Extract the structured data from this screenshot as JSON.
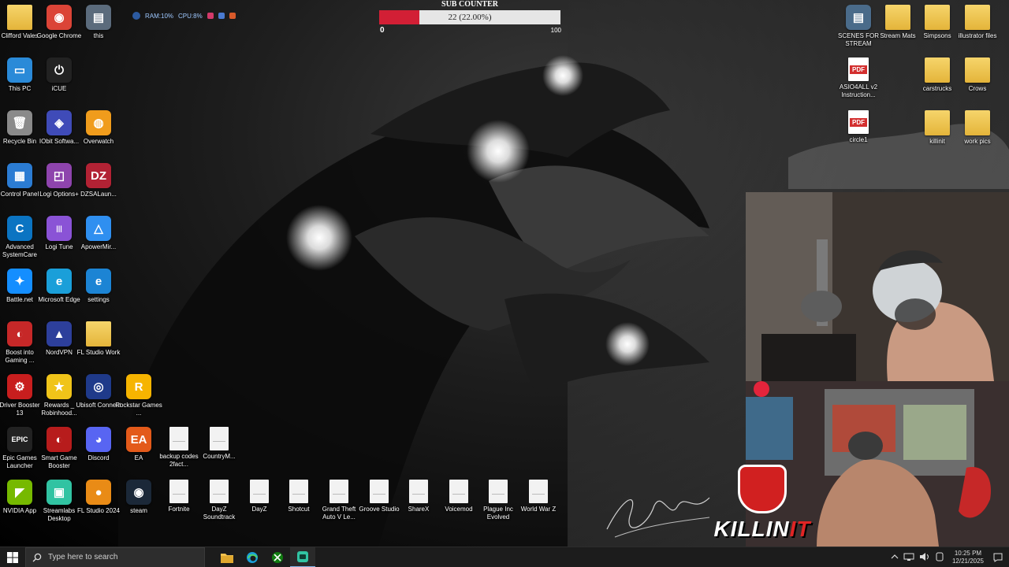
{
  "desktop": {
    "icons": [
      {
        "id": "clifford-vales",
        "label": "Clifford Vales",
        "kind": "folder",
        "color": "#e4b43a",
        "glyph": ""
      },
      {
        "id": "google-chrome",
        "label": "Google Chrome",
        "kind": "app",
        "color": "#db4437",
        "glyph": "◉"
      },
      {
        "id": "this",
        "label": "this",
        "kind": "app",
        "color": "#5b6b7c",
        "glyph": "▤"
      },
      {
        "id": "this-pc",
        "label": "This PC",
        "kind": "app",
        "color": "#2a8ad8",
        "glyph": "▭"
      },
      {
        "id": "icue",
        "label": "iCUE",
        "kind": "app",
        "color": "#222222",
        "glyph": "⏻"
      },
      {
        "id": "recycle-bin",
        "label": "Recycle Bin",
        "kind": "app",
        "color": "#8a8a8a",
        "glyph": "🗑"
      },
      {
        "id": "iobit-software",
        "label": "IObit Softwa...",
        "kind": "app",
        "color": "#3f4bb8",
        "glyph": "◈"
      },
      {
        "id": "overwatch",
        "label": "Overwatch",
        "kind": "app",
        "color": "#f09c1c",
        "glyph": "◍"
      },
      {
        "id": "control-panel",
        "label": "Control Panel",
        "kind": "app",
        "color": "#2b7cd3",
        "glyph": "▦"
      },
      {
        "id": "logi-options",
        "label": "Logi Options+",
        "kind": "app",
        "color": "#8e44ad",
        "glyph": "◰"
      },
      {
        "id": "dzsalauncher",
        "label": "DZSALaun...",
        "kind": "app",
        "color": "#b22234",
        "glyph": "DZ"
      },
      {
        "id": "advanced-systemcare",
        "label": "Advanced SystemCare",
        "kind": "app",
        "color": "#0b74c2",
        "glyph": "C"
      },
      {
        "id": "logi-tune",
        "label": "Logi Tune",
        "kind": "app",
        "color": "#8a53d6",
        "glyph": "|||"
      },
      {
        "id": "apowermirror",
        "label": "ApowerMir...",
        "kind": "app",
        "color": "#2f8ff0",
        "glyph": "△"
      },
      {
        "id": "battle-net",
        "label": "Battle.net",
        "kind": "app",
        "color": "#148eff",
        "glyph": "✦"
      },
      {
        "id": "microsoft-edge",
        "label": "Microsoft Edge",
        "kind": "app",
        "color": "#1a9fd9",
        "glyph": "e"
      },
      {
        "id": "settings",
        "label": "settings",
        "kind": "app",
        "color": "#1c84d4",
        "glyph": "e"
      },
      {
        "id": "boost-into-gaming",
        "label": "Boost into Gaming ...",
        "kind": "app",
        "color": "#c62828",
        "glyph": "◐"
      },
      {
        "id": "nordvpn",
        "label": "NordVPN",
        "kind": "app",
        "color": "#2d3f9b",
        "glyph": "▲"
      },
      {
        "id": "fl-studio-work",
        "label": "FL Studio Work",
        "kind": "folder",
        "color": "#e4b43a",
        "glyph": ""
      },
      {
        "id": "driver-booster-13",
        "label": "Driver Booster 13",
        "kind": "app",
        "color": "#c81e1e",
        "glyph": "⚙"
      },
      {
        "id": "rewards-robinhood",
        "label": "Rewards _ Robinhood...",
        "kind": "app",
        "color": "#f0c419",
        "glyph": "★"
      },
      {
        "id": "ubisoft-connect",
        "label": "Ubisoft Connect",
        "kind": "app",
        "color": "#1f3a8a",
        "glyph": "◎"
      },
      {
        "id": "rockstar-games",
        "label": "Rockstar Games ...",
        "kind": "app",
        "color": "#f6b400",
        "glyph": "R"
      },
      {
        "id": "epic-games",
        "label": "Epic Games Launcher",
        "kind": "app",
        "color": "#222222",
        "glyph": "EPIC"
      },
      {
        "id": "smart-game-booster",
        "label": "Smart Game Booster",
        "kind": "app",
        "color": "#b71c1c",
        "glyph": "◐"
      },
      {
        "id": "discord",
        "label": "Discord",
        "kind": "app",
        "color": "#5865f2",
        "glyph": "◕"
      },
      {
        "id": "ea",
        "label": "EA",
        "kind": "app",
        "color": "#e35a1a",
        "glyph": "EA"
      },
      {
        "id": "backup-codes",
        "label": "backup codes 2fact...",
        "kind": "file",
        "color": "#f2f2f2",
        "glyph": ""
      },
      {
        "id": "countrym",
        "label": "CountryM...",
        "kind": "file",
        "color": "#f2f2f2",
        "glyph": ""
      },
      {
        "id": "nvidia-app",
        "label": "NVIDIA App",
        "kind": "app",
        "color": "#76b900",
        "glyph": "◤"
      },
      {
        "id": "streamlabs-desktop",
        "label": "Streamlabs Desktop",
        "kind": "app",
        "color": "#31c3a2",
        "glyph": "▣"
      },
      {
        "id": "fl-studio-2024",
        "label": "FL Studio 2024",
        "kind": "app",
        "color": "#e98b16",
        "glyph": "●"
      },
      {
        "id": "steam",
        "label": "steam",
        "kind": "app",
        "color": "#1b2838",
        "glyph": "◉"
      },
      {
        "id": "fortnite",
        "label": "Fortnite",
        "kind": "file",
        "color": "#f2f2f2",
        "glyph": ""
      },
      {
        "id": "dayz-soundtrack",
        "label": "DayZ Soundtrack",
        "kind": "file",
        "color": "#f2f2f2",
        "glyph": ""
      },
      {
        "id": "dayz",
        "label": "DayZ",
        "kind": "file",
        "color": "#f2f2f2",
        "glyph": ""
      },
      {
        "id": "shotcut",
        "label": "Shotcut",
        "kind": "file",
        "color": "#f2f2f2",
        "glyph": ""
      },
      {
        "id": "gta-v",
        "label": "Grand Theft Auto V Le...",
        "kind": "file",
        "color": "#f2f2f2",
        "glyph": ""
      },
      {
        "id": "groove-studio",
        "label": "Groove Studio",
        "kind": "file",
        "color": "#f2f2f2",
        "glyph": ""
      },
      {
        "id": "sharex",
        "label": "ShareX",
        "kind": "file",
        "color": "#f2f2f2",
        "glyph": ""
      },
      {
        "id": "voicemod",
        "label": "Voicemod",
        "kind": "file",
        "color": "#f2f2f2",
        "glyph": ""
      },
      {
        "id": "plague-inc",
        "label": "Plague Inc Evolved",
        "kind": "file",
        "color": "#f2f2f2",
        "glyph": ""
      },
      {
        "id": "world-war-z",
        "label": "World War Z",
        "kind": "file",
        "color": "#f2f2f2",
        "glyph": ""
      },
      {
        "id": "scenes-for-stream",
        "label": "SCENES FOR STREAM",
        "kind": "app",
        "color": "#4a6b8a",
        "glyph": "▤"
      },
      {
        "id": "stream-mats",
        "label": "Stream Mats",
        "kind": "folder",
        "color": "#e4b43a",
        "glyph": ""
      },
      {
        "id": "simpsons",
        "label": "Simpsons",
        "kind": "folder",
        "color": "#e4b43a",
        "glyph": ""
      },
      {
        "id": "illustrator-files",
        "label": "illustrator files",
        "kind": "folder",
        "color": "#e4b43a",
        "glyph": ""
      },
      {
        "id": "asio4all",
        "label": "ASIO4ALL v2 Instruction...",
        "kind": "pdf",
        "color": "#d32f2f",
        "glyph": "PDF"
      },
      {
        "id": "carstrucks",
        "label": "carstrucks",
        "kind": "folder",
        "color": "#e4b43a",
        "glyph": ""
      },
      {
        "id": "crows",
        "label": "Crows",
        "kind": "folder",
        "color": "#e4b43a",
        "glyph": ""
      },
      {
        "id": "circle1",
        "label": "circle1",
        "kind": "pdf",
        "color": "#d32f2f",
        "glyph": "PDF"
      },
      {
        "id": "killinit",
        "label": "killinit",
        "kind": "folder",
        "color": "#e4b43a",
        "glyph": ""
      },
      {
        "id": "work-pics",
        "label": "work pics",
        "kind": "folder",
        "color": "#e4b43a",
        "glyph": ""
      }
    ]
  },
  "perf_overlay": {
    "ram": "RAM:10%",
    "cpu": "CPU:8%"
  },
  "sub_counter": {
    "title": "SUB COUNTER",
    "current": 22,
    "goal": 100,
    "progress_fraction": 0.22,
    "text": "22 (22.00%)",
    "min_label": "0",
    "max_label": "100",
    "fill_color": "#d21f35"
  },
  "logo": {
    "word_a": "KILLIN",
    "word_b": "IT"
  },
  "taskbar": {
    "search_placeholder": "Type here to search",
    "apps": [
      {
        "id": "file-explorer",
        "icon": "folder-icon",
        "color": "#f2c14e"
      },
      {
        "id": "edge",
        "icon": "edge-icon",
        "color": "#1a9fd9"
      },
      {
        "id": "xbox",
        "icon": "xbox-icon",
        "color": "#107c10"
      },
      {
        "id": "streamlabs",
        "icon": "streamlabs-icon",
        "color": "#31c3a2"
      }
    ],
    "time": "10:25 PM",
    "date": "12/21/2025"
  }
}
